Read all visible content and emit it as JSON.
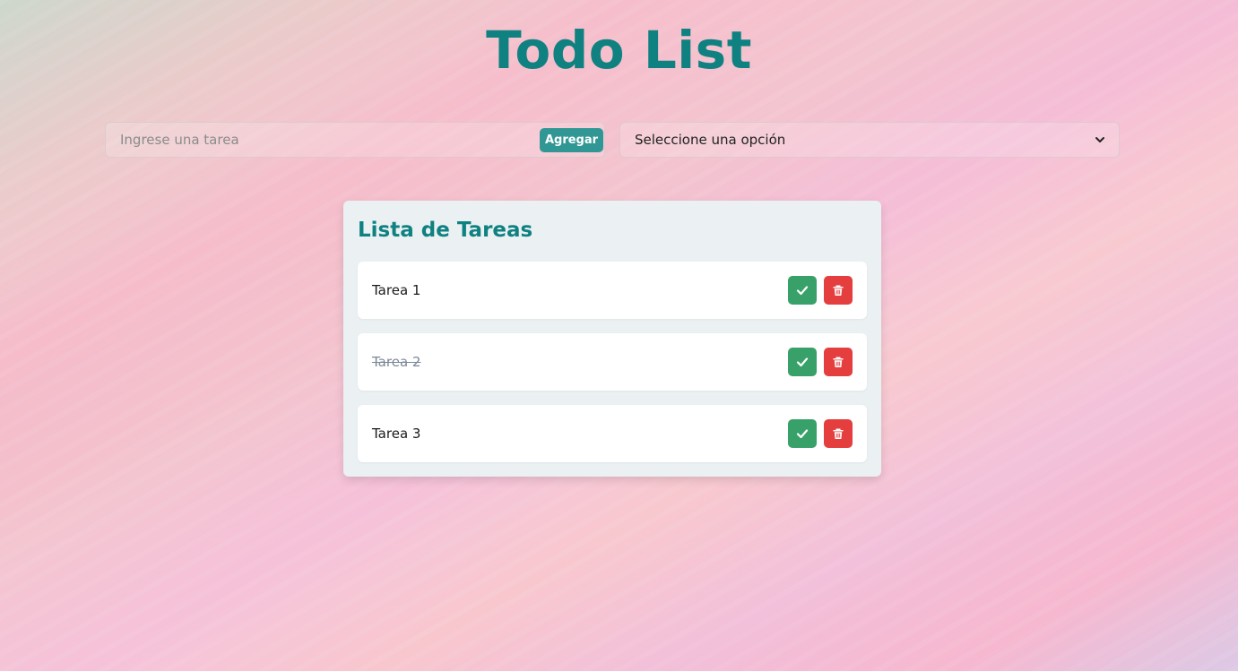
{
  "header": {
    "title": "Todo List"
  },
  "form": {
    "task_placeholder": "Ingrese una tarea",
    "task_value": "",
    "add_label": "Agregar",
    "filter_selected": "Seleccione una opción"
  },
  "list": {
    "title": "Lista de Tareas",
    "tasks": [
      {
        "text": "Tarea 1",
        "completed": false
      },
      {
        "text": "Tarea 2",
        "completed": true
      },
      {
        "text": "Tarea 3",
        "completed": false
      }
    ]
  },
  "colors": {
    "accent": "#0f8181",
    "add_button": "#319795",
    "complete_button": "#38a169",
    "delete_button": "#e53e3e"
  },
  "icons": {
    "complete": "check-icon",
    "delete": "trash-icon",
    "dropdown": "chevron-down-icon"
  }
}
